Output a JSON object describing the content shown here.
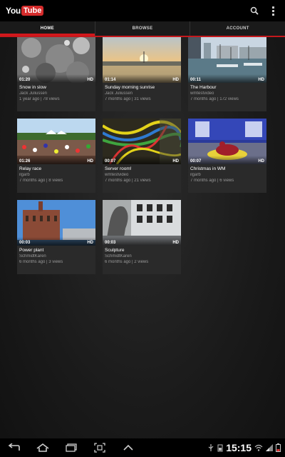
{
  "app": {
    "logo_you": "You",
    "logo_tube": "Tube"
  },
  "tabs": [
    {
      "label": "HOME"
    },
    {
      "label": "BROWSE"
    },
    {
      "label": "ACCOUNT"
    }
  ],
  "videos": [
    {
      "title": "Snow in slow",
      "author": "Jack Juliussen",
      "stats": "1 year ago | 78 views",
      "duration": "01:20",
      "hd": "HD"
    },
    {
      "title": "Sunday morning sunrise",
      "author": "Jack Juliussen",
      "stats": "7 months ago | 31 views",
      "duration": "01:14",
      "hd": "HD"
    },
    {
      "title": "The Harbour",
      "author": "wmtestvideo",
      "stats": "7 months ago | 172 views",
      "duration": "00:11",
      "hd": "HD"
    },
    {
      "title": "Relay race",
      "author": "ilgarb",
      "stats": "7 months ago | 8 views",
      "duration": "01:26",
      "hd": "HD"
    },
    {
      "title": "Server room!",
      "author": "wmtestvideo",
      "stats": "7 months ago | 21 views",
      "duration": "00:07",
      "hd": "HD"
    },
    {
      "title": "Christmas in WM",
      "author": "ilgarb",
      "stats": "7 months ago | 6 views",
      "duration": "00:07",
      "hd": "HD"
    },
    {
      "title": "Power plant",
      "author": "SchmidtKaren",
      "stats": "6 months ago | 3 views",
      "duration": "00:03",
      "hd": "HD"
    },
    {
      "title": "Sculpture",
      "author": "SchmidtKaren",
      "stats": "6 months ago | 2 views",
      "duration": "00:03",
      "hd": "HD"
    }
  ],
  "statusbar": {
    "clock": "15:15"
  },
  "icons": {
    "search": "search-icon",
    "overflow": "overflow-menu-icon",
    "back": "back-icon",
    "home": "home-icon",
    "recent": "recent-apps-icon",
    "screenshot": "screenshot-icon",
    "up": "chevron-up-icon",
    "usb": "usb-icon",
    "wifi": "wifi-icon",
    "signal": "signal-icon",
    "battery": "battery-icon"
  },
  "colors": {
    "accent": "#d3181c",
    "background": "#1c1c1c",
    "card": "#2a2a2a"
  }
}
